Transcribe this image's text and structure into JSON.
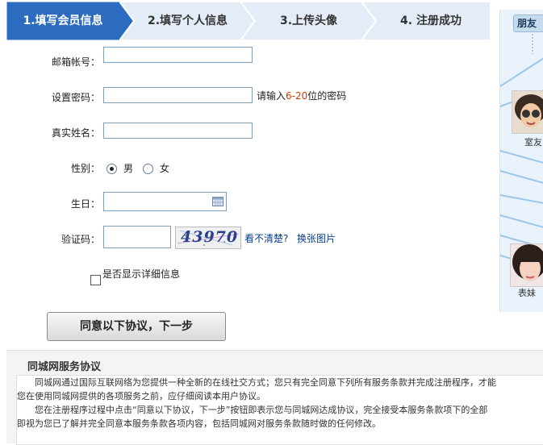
{
  "steps": [
    {
      "label": "1.填写会员信息",
      "active": true
    },
    {
      "label": "2.填写个人信息",
      "active": false
    },
    {
      "label": "3.上传头像",
      "active": false
    },
    {
      "label": "4. 注册成功",
      "active": false
    }
  ],
  "form": {
    "email_label": "邮箱帐号：",
    "password_label": "设置密码：",
    "password_hint_prefix": "请输入",
    "password_hint_range": "6-20",
    "password_hint_suffix": "位的密码",
    "realname_label": "真实姓名：",
    "gender_label": "性别：",
    "gender_male": "男",
    "gender_female": "女",
    "birthday_label": "生日：",
    "captcha_label": "验证码：",
    "captcha_text": "43970",
    "captcha_unclear": "看不清楚?",
    "captcha_change": "换张图片",
    "show_details": "是否显示详细信息",
    "submit": "同意以下协议，下一步"
  },
  "agreement": {
    "title": "同城网服务协议",
    "lines": [
      "　　同城网通过国际互联网络为您提供一种全新的在线社交方式；您只有完全同意下列所有服务条款并完成注册程序，才能",
      "您在使用同城网提供的各项服务之前，应仔细阅读本用户协议。",
      "　　您在注册程序过程中点击“同意以下协议，下一步”按钮即表示您与同城网达成协议，完全接受本服务条款项下的全部",
      "即视为您已了解并完全同意本服务条款各项内容，包括同城网对服务条款随时做的任何修改。"
    ]
  },
  "sidebar": {
    "tab": "朋友",
    "name1": "室友",
    "name2": "表妹"
  },
  "colors": {
    "step_active": "#2b6cc0",
    "step_inactive": "#e4edf7",
    "hint_accent": "#d43a00",
    "link": "#0b3f8c"
  }
}
